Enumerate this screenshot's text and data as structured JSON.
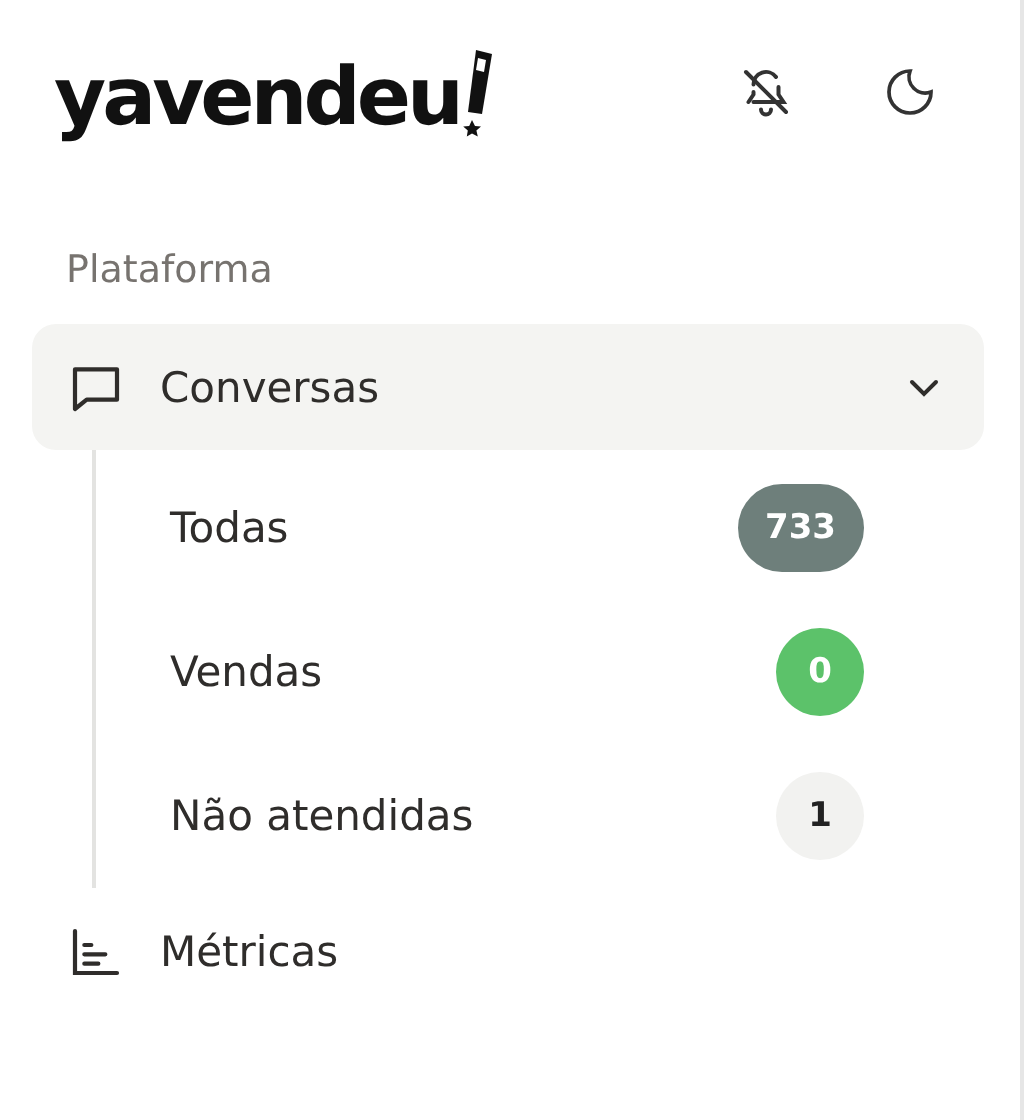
{
  "brand": {
    "name": "yavendeu"
  },
  "header_actions": [
    {
      "kind": "bell-off"
    },
    {
      "kind": "moon"
    }
  ],
  "section_label": "Plataforma",
  "nav": [
    {
      "label": "Conversas",
      "kind": "chat",
      "selected": true,
      "expanded": true,
      "children": [
        {
          "label": "Todas",
          "count": "733",
          "color": "#6e7f7b"
        },
        {
          "label": "Vendas",
          "count": "0",
          "color": "#5cc26a"
        },
        {
          "label": "Não atendidas",
          "count": "1",
          "color": "#f2f2f0"
        }
      ]
    },
    {
      "label": "Métricas",
      "kind": "chart",
      "selected": false
    }
  ]
}
